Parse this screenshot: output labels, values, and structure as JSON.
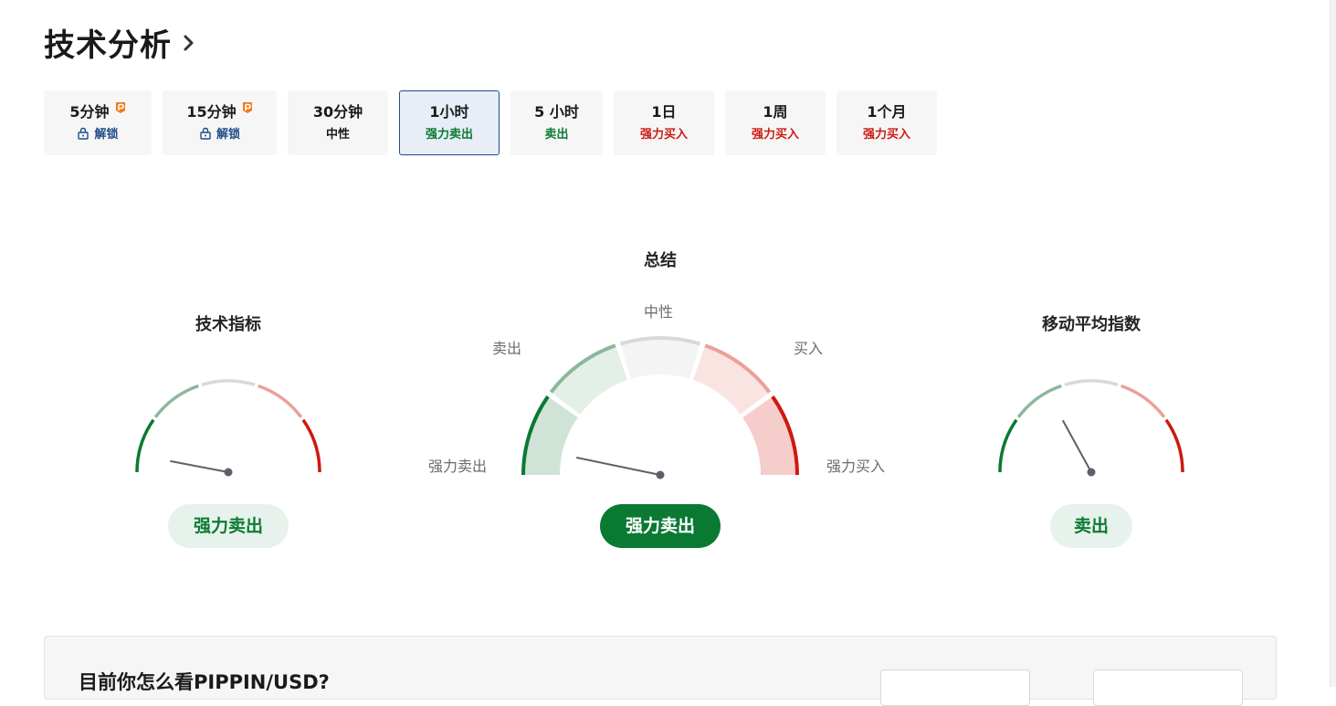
{
  "header": {
    "title": "技术分析"
  },
  "timeframes": [
    {
      "label": "5分钟",
      "status": "解锁",
      "locked": true,
      "pro": true,
      "tone": "unlock"
    },
    {
      "label": "15分钟",
      "status": "解锁",
      "locked": true,
      "pro": true,
      "tone": "unlock"
    },
    {
      "label": "30分钟",
      "status": "中性",
      "locked": false,
      "pro": false,
      "tone": "neutral"
    },
    {
      "label": "1小时",
      "status": "强力卖出",
      "locked": false,
      "pro": false,
      "tone": "sell",
      "active": true
    },
    {
      "label": "5 小时",
      "status": "卖出",
      "locked": false,
      "pro": false,
      "tone": "sell"
    },
    {
      "label": "1日",
      "status": "强力买入",
      "locked": false,
      "pro": false,
      "tone": "buy"
    },
    {
      "label": "1周",
      "status": "强力买入",
      "locked": false,
      "pro": false,
      "tone": "buy"
    },
    {
      "label": "1个月",
      "status": "强力买入",
      "locked": false,
      "pro": false,
      "tone": "buy"
    }
  ],
  "gauges": {
    "indicators": {
      "title": "技术指标",
      "verdict": "强力卖出",
      "needle_value": 0.06
    },
    "summary": {
      "title": "总结",
      "verdict": "强力卖出",
      "needle_value": 0.065,
      "labels": {
        "strong_sell": "强力卖出",
        "sell": "卖出",
        "neutral": "中性",
        "buy": "买入",
        "strong_buy": "强力买入"
      }
    },
    "moving_averages": {
      "title": "移动平均指数",
      "verdict": "卖出",
      "needle_value": 0.34
    }
  },
  "sentiment": {
    "question": "目前你怎么看PIPPIN/USD?"
  },
  "colors": {
    "strong_sell": "#0a7a33",
    "sell": "#8bb89b",
    "neutral": "#d9d9d9",
    "buy": "#eba09b",
    "strong_buy": "#cc1a10",
    "needle": "#5d6068"
  },
  "icons": {
    "title_arrow": "chevron-right-icon",
    "pro": "pro-badge-icon",
    "lock": "lock-icon"
  }
}
